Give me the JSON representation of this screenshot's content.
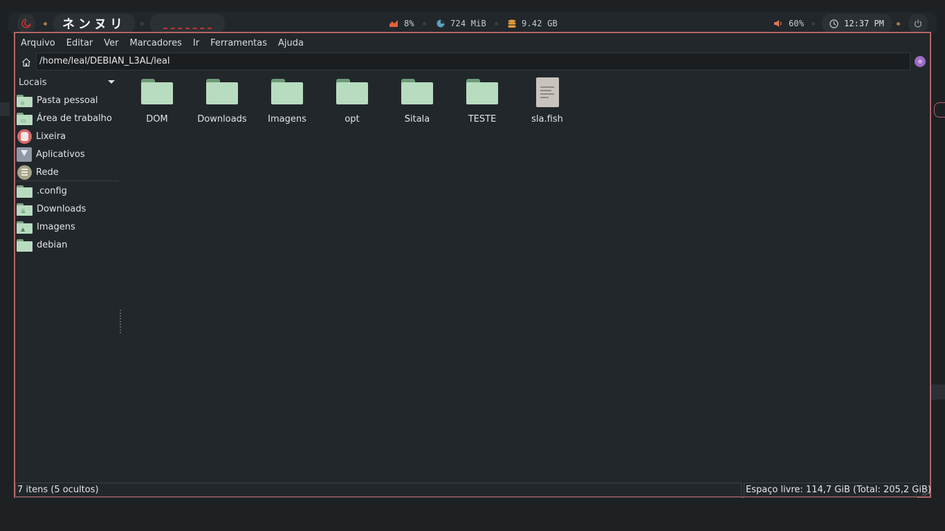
{
  "topbar": {
    "logo_text": "ネンヌリ",
    "cpu": "8%",
    "ram": "724 MiB",
    "disk": "9.42 GB",
    "volume": "60%",
    "clock": "12:37 PM",
    "icons": [
      "debian-swirl-icon",
      "cpu-chart-icon",
      "ram-pie-icon",
      "disk-db-icon",
      "speaker-icon",
      "clock-icon",
      "power-icon"
    ],
    "colors": {
      "accent_red": "#c73434",
      "cpu_icon": "#e0623a",
      "ram_icon": "#5aa0b8",
      "disk_icon": "#e09a3a",
      "dot": "#a07a4a"
    }
  },
  "menubar": {
    "items": [
      "Arquivo",
      "Editar",
      "Ver",
      "Marcadores",
      "Ir",
      "Ferramentas",
      "Ajuda"
    ]
  },
  "address": {
    "path": "/home/leal/DEBIAN_L3AL/leal"
  },
  "sidebar": {
    "header": "Locais",
    "places": [
      {
        "label": "Pasta pessoal",
        "icon": "home-folder-icon"
      },
      {
        "label": "Área de trabalho",
        "icon": "desktop-folder-icon"
      },
      {
        "label": "Lixeira",
        "icon": "trash-icon"
      },
      {
        "label": "Aplicativos",
        "icon": "applications-icon"
      },
      {
        "label": "Rede",
        "icon": "network-icon"
      }
    ],
    "bookmarks": [
      {
        "label": ".config",
        "icon": "folder-icon"
      },
      {
        "label": "Downloads",
        "icon": "downloads-folder-icon"
      },
      {
        "label": "Imagens",
        "icon": "pictures-folder-icon"
      },
      {
        "label": "debian",
        "icon": "folder-icon"
      }
    ]
  },
  "files": [
    {
      "name": "DOM",
      "type": "folder"
    },
    {
      "name": "Downloads",
      "type": "folder"
    },
    {
      "name": "Imagens",
      "type": "folder"
    },
    {
      "name": "opt",
      "type": "folder"
    },
    {
      "name": "Sitala",
      "type": "folder"
    },
    {
      "name": "TESTE",
      "type": "folder"
    },
    {
      "name": "sla.fish",
      "type": "text-file"
    }
  ],
  "status": {
    "count": "7 itens (5 ocultos)",
    "free_space": "Espaço livre: 114,7 GiB (Total: 205,2 GiB)"
  },
  "colors": {
    "window_border": "#b56568",
    "folder_body": "#b8dcc0",
    "folder_tab": "#6d9a76",
    "background": "#22272b"
  }
}
